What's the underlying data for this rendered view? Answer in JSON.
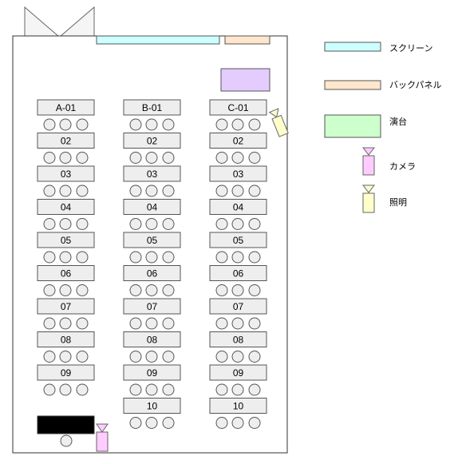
{
  "legend": [
    {
      "key": "screen",
      "label": "スクリーン",
      "color": "#ccffff"
    },
    {
      "key": "backpanel",
      "label": "バックパネル",
      "color": "#ffe6cc"
    },
    {
      "key": "stage",
      "label": "演台",
      "color": "#ccffcc"
    },
    {
      "key": "camera",
      "label": "カメラ",
      "color": "#ffccff"
    },
    {
      "key": "light",
      "label": "照明",
      "color": "#ffffcc"
    }
  ],
  "colors": {
    "room_outline": "#333333",
    "table_fill": "#eeeeee",
    "seat_fill": "#eeeeee",
    "podium_fill": "#e5ccff",
    "control_desk_fill": "#000000"
  },
  "columns": [
    {
      "id": "A",
      "tables": [
        "A-01",
        "02",
        "03",
        "04",
        "05",
        "06",
        "07",
        "08",
        "09"
      ]
    },
    {
      "id": "B",
      "tables": [
        "B-01",
        "02",
        "03",
        "04",
        "05",
        "06",
        "07",
        "08",
        "09",
        "10"
      ]
    },
    {
      "id": "C",
      "tables": [
        "C-01",
        "02",
        "03",
        "04",
        "05",
        "06",
        "07",
        "08",
        "09",
        "10"
      ]
    }
  ],
  "seats_per_table": 3
}
